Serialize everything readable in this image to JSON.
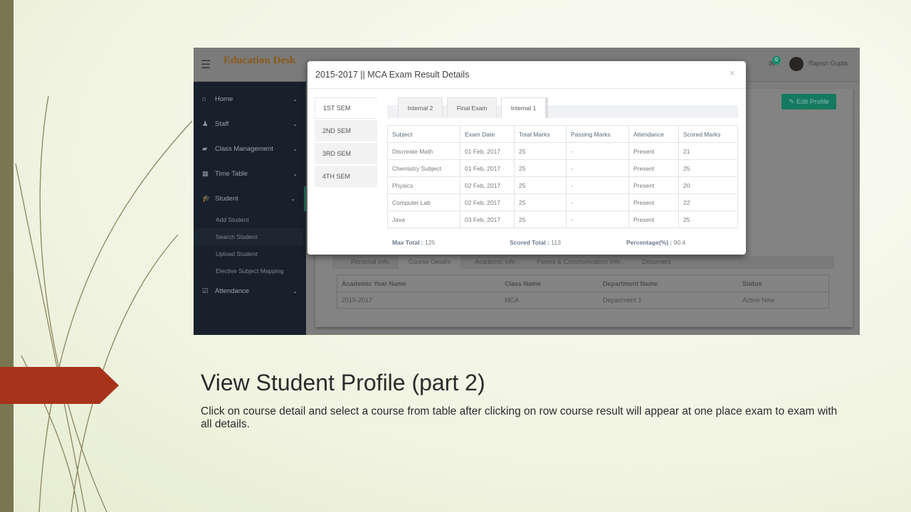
{
  "slide": {
    "title": "View Student Profile (part 2)",
    "description": "Click on course detail and select a course from table after clicking on row course result will appear at one place exam to exam with all details."
  },
  "app": {
    "logo_text": "Education Desk",
    "notification_count": "0",
    "user_name": "Rajesh Gupta",
    "edit_profile_label": "Edit Profile"
  },
  "sidebar": {
    "items": [
      {
        "label": "Home",
        "icon": "home-icon"
      },
      {
        "label": "Staff",
        "icon": "user-icon"
      },
      {
        "label": "Class Management",
        "icon": "book-icon"
      },
      {
        "label": "Time Table",
        "icon": "calendar-icon"
      },
      {
        "label": "Student",
        "icon": "graduation-cap-icon"
      }
    ],
    "student_sub": [
      "Add Student",
      "Search Student",
      "Upload Student",
      "Elective Subject Mapping"
    ],
    "attendance": "Attendance"
  },
  "profile_tabs": [
    "Personal Info",
    "Course Details",
    "Academic Info",
    "Parent & Communication Info",
    "Document"
  ],
  "course_table": {
    "headers": [
      "Academic Year Name",
      "Class Name",
      "Department Name",
      "Status"
    ],
    "row": [
      "2015-2017",
      "MCA",
      "Department 1",
      "Active Now"
    ]
  },
  "modal": {
    "title": "2015-2017 || MCA Exam Result Details",
    "close": "×",
    "semesters": [
      "1ST SEM",
      "2ND SEM",
      "3RD SEM",
      "4TH SEM"
    ],
    "exam_tabs": [
      "Internal 2",
      "Final Exam",
      "Internal 1"
    ],
    "headers": [
      "Subject",
      "Exam Date",
      "Total Marks",
      "Passing Marks",
      "Attendance",
      "Scored Marks"
    ],
    "rows": [
      [
        "Discreate Math",
        "01 Feb, 2017",
        "25",
        "-",
        "Present",
        "21"
      ],
      [
        "Chemistry Subject",
        "01 Feb, 2017",
        "25",
        "-",
        "Present",
        "25"
      ],
      [
        "Physics",
        "02 Feb, 2017",
        "25",
        "-",
        "Present",
        "20"
      ],
      [
        "Computer Lab",
        "02 Feb, 2017",
        "25",
        "-",
        "Present",
        "22"
      ],
      [
        "Java",
        "03 Feb, 2017",
        "25",
        "-",
        "Present",
        "25"
      ]
    ],
    "max_total_label": "Max Total :",
    "max_total": "125",
    "scored_total_label": "Scored Total :",
    "scored_total": "113",
    "percentage_label": "Percentage(%) :",
    "percentage": "90.4"
  }
}
